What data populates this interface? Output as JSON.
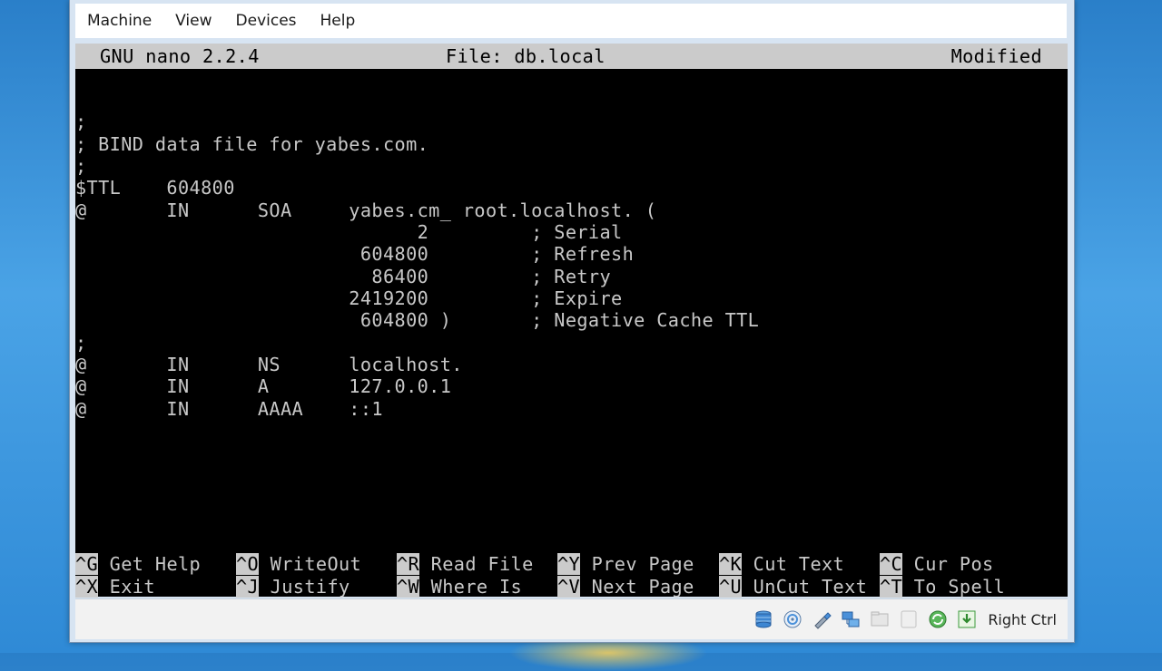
{
  "menubar": {
    "items": [
      "Machine",
      "View",
      "Devices",
      "Help"
    ]
  },
  "nano": {
    "version": "GNU nano 2.2.4",
    "file_label": "File: db.local",
    "state": "Modified",
    "lines": [
      "",
      ";",
      "; BIND data file for yabes.com.",
      ";",
      "$TTL    604800",
      "@       IN      SOA     yabes.cm_ root.localhost. (",
      "                              2         ; Serial",
      "                         604800         ; Refresh",
      "                          86400         ; Retry",
      "                        2419200         ; Expire",
      "                         604800 )       ; Negative Cache TTL",
      ";",
      "@       IN      NS      localhost.",
      "@       IN      A       127.0.0.1",
      "@       IN      AAAA    ::1"
    ],
    "shortcuts_row1": [
      {
        "key": "^G",
        "label": "Get Help"
      },
      {
        "key": "^O",
        "label": "WriteOut"
      },
      {
        "key": "^R",
        "label": "Read File"
      },
      {
        "key": "^Y",
        "label": "Prev Page"
      },
      {
        "key": "^K",
        "label": "Cut Text"
      },
      {
        "key": "^C",
        "label": "Cur Pos"
      }
    ],
    "shortcuts_row2": [
      {
        "key": "^X",
        "label": "Exit"
      },
      {
        "key": "^J",
        "label": "Justify"
      },
      {
        "key": "^W",
        "label": "Where Is"
      },
      {
        "key": "^V",
        "label": "Next Page"
      },
      {
        "key": "^U",
        "label": "UnCut Text"
      },
      {
        "key": "^T",
        "label": "To Spell"
      }
    ]
  },
  "statusbar": {
    "icons": [
      "hard-disk-icon",
      "optical-drive-icon",
      "usb-icon",
      "network-icon",
      "shared-folders-icon",
      "display-icon",
      "virtualization-icon",
      "mouse-integration-icon"
    ],
    "host_key": "Right Ctrl"
  },
  "colors": {
    "terminal_bg": "#000000",
    "terminal_fg": "#c8c8c8",
    "inverse_bg": "#cbcbcb"
  }
}
